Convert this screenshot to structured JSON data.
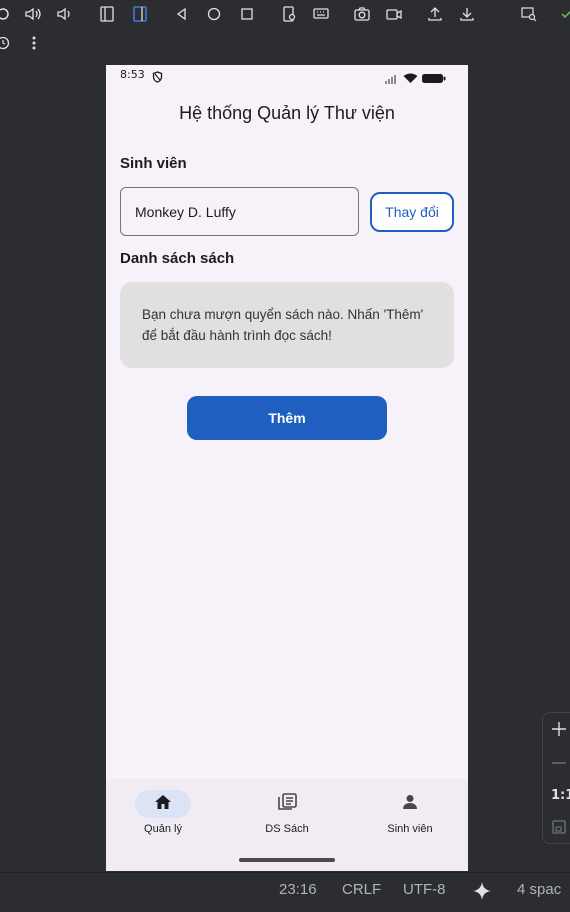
{
  "ide": {
    "toolbar_icons": [
      "rotate-left-icon",
      "volume-up-icon",
      "volume-down-icon",
      "fold-left-icon",
      "fold-right-icon",
      "back-icon",
      "home-icon",
      "overview-icon",
      "settings-phone-icon",
      "keyboard-icon",
      "camera-icon",
      "record-icon",
      "upload-icon",
      "download-icon",
      "search-window-icon",
      "check-icon"
    ],
    "toolbar2_icons": [
      "history-icon",
      "more-vert-icon"
    ],
    "zoom": {
      "one_to_one": "1:1"
    },
    "status": {
      "position": "23:16",
      "line_endings": "CRLF",
      "encoding": "UTF-8",
      "indent": "4 spac"
    }
  },
  "phone": {
    "status_bar": {
      "time": "8:53"
    },
    "app_title": "Hệ thống Quản lý Thư viện",
    "student_section": {
      "label": "Sinh viên",
      "value": "Monkey D. Luffy",
      "change_button": "Thay đổi"
    },
    "books_section": {
      "label": "Danh sách sách",
      "empty_message": "Bạn chưa mượn quyển sách nào. Nhấn 'Thêm' để bắt đầu hành trình đọc sách!",
      "add_button": "Thêm"
    },
    "bottom_nav": [
      {
        "label": "Quản lý",
        "icon": "home-icon",
        "active": true
      },
      {
        "label": "DS Sách",
        "icon": "library-books-icon",
        "active": false
      },
      {
        "label": "Sinh viên",
        "icon": "person-icon",
        "active": false
      }
    ]
  },
  "colors": {
    "primary": "#1f5fbf",
    "phone_bg": "#f7f2fa",
    "ide_bg": "#2b2d30"
  }
}
